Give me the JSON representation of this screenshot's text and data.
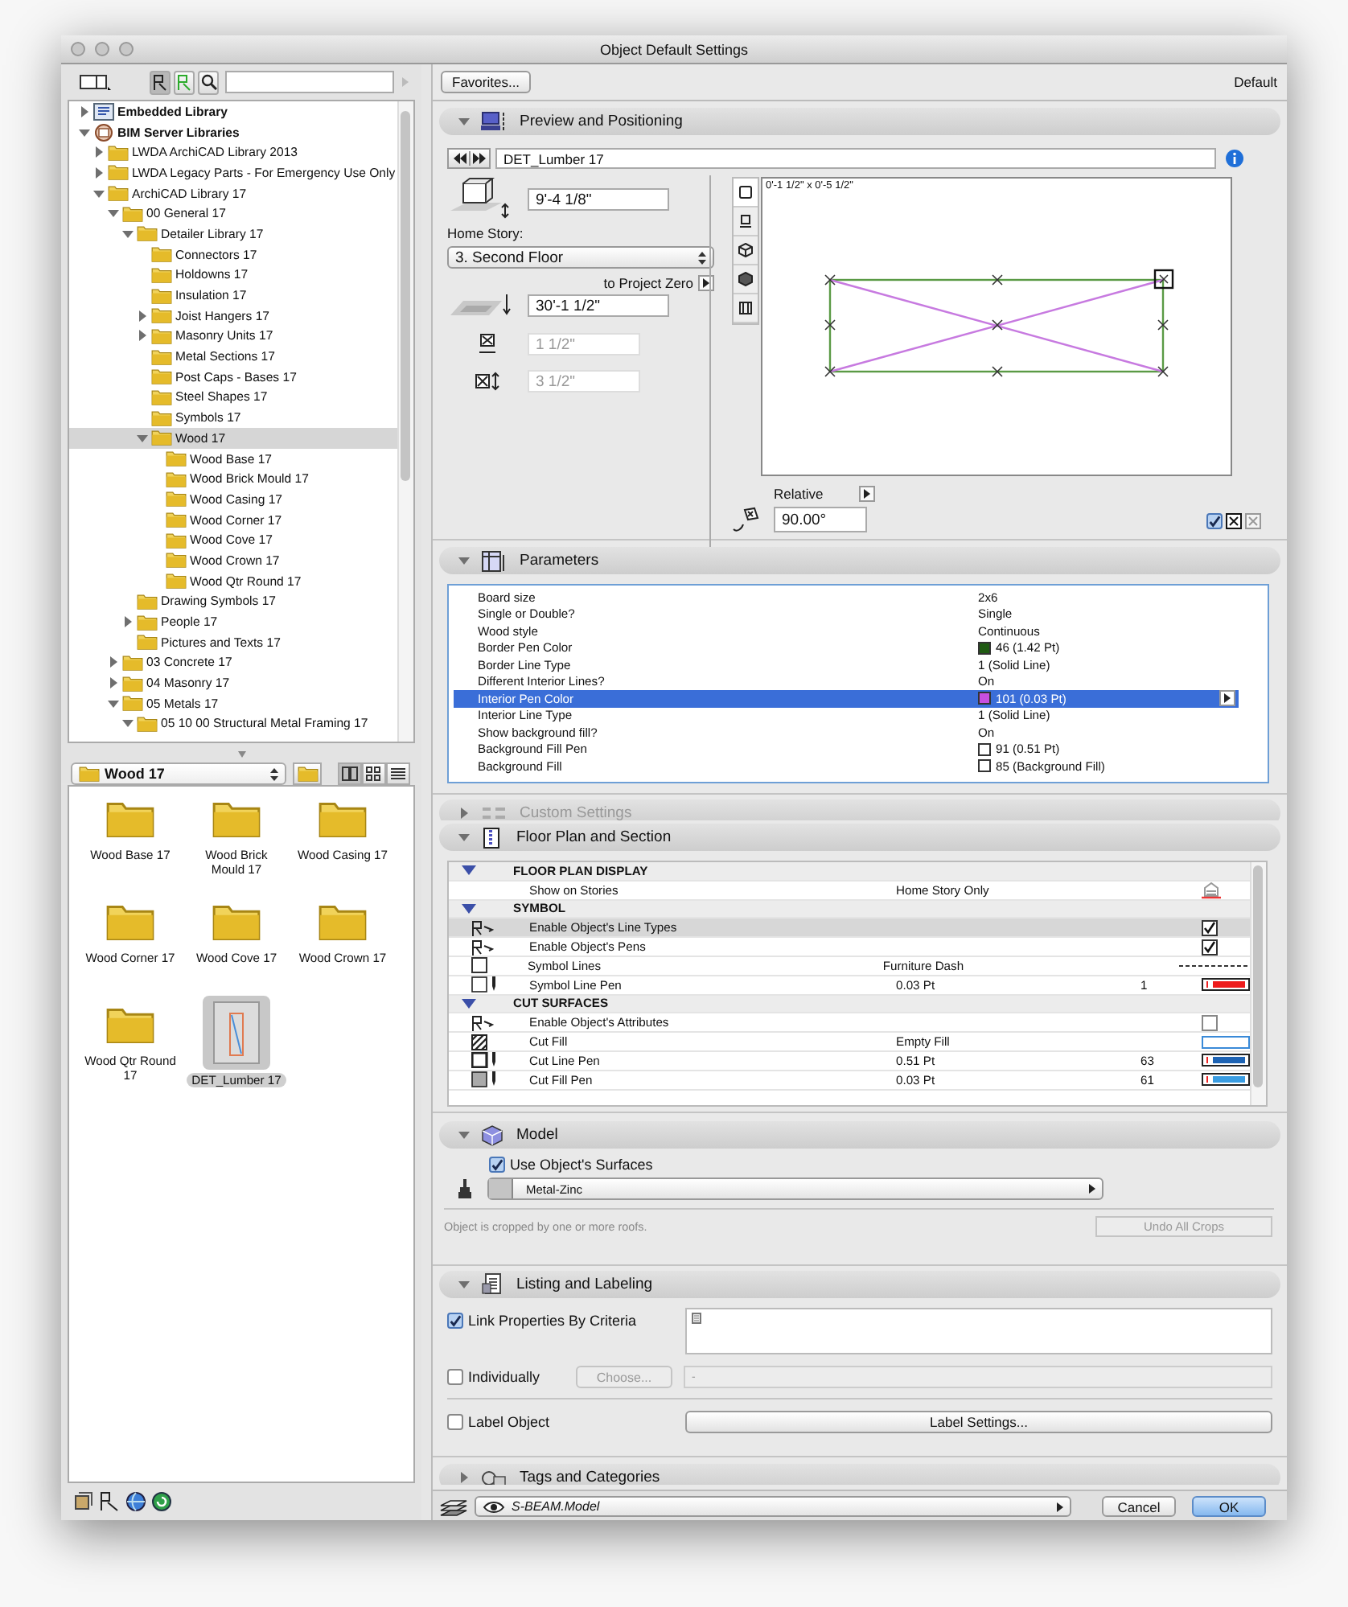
{
  "window": {
    "title": "Object Default Settings"
  },
  "tree": [
    {
      "label": "Embedded Library",
      "kind": "library",
      "expanded": false,
      "selected": false
    },
    {
      "label": "BIM Server Libraries",
      "kind": "server",
      "expanded": true,
      "selected": false,
      "children": [
        {
          "label": "LWDA ArchiCAD Library 2013",
          "kind": "folder",
          "expanded": false,
          "selected": false
        },
        {
          "label": "LWDA Legacy Parts - For Emergency Use Only",
          "kind": "folder",
          "expanded": false,
          "selected": false
        },
        {
          "label": "ArchiCAD Library 17",
          "kind": "folder",
          "expanded": true,
          "selected": false,
          "children": [
            {
              "label": "00 General 17",
              "kind": "folder",
              "expanded": true,
              "selected": false,
              "children": [
                {
                  "label": "Detailer Library 17",
                  "kind": "folder",
                  "expanded": true,
                  "selected": false,
                  "children": [
                    {
                      "label": "Connectors 17",
                      "kind": "folder",
                      "selected": false
                    },
                    {
                      "label": "Holdowns 17",
                      "kind": "folder",
                      "selected": false
                    },
                    {
                      "label": "Insulation 17",
                      "kind": "folder",
                      "selected": false
                    },
                    {
                      "label": "Joist Hangers 17",
                      "kind": "folder",
                      "expanded": false,
                      "selected": false
                    },
                    {
                      "label": "Masonry Units 17",
                      "kind": "folder",
                      "expanded": false,
                      "selected": false
                    },
                    {
                      "label": "Metal Sections 17",
                      "kind": "folder",
                      "selected": false
                    },
                    {
                      "label": "Post Caps - Bases 17",
                      "kind": "folder",
                      "selected": false
                    },
                    {
                      "label": "Steel Shapes 17",
                      "kind": "folder",
                      "selected": false
                    },
                    {
                      "label": "Symbols 17",
                      "kind": "folder",
                      "selected": false
                    },
                    {
                      "label": "Wood 17",
                      "kind": "folder",
                      "expanded": true,
                      "selected": true,
                      "children": [
                        {
                          "label": "Wood Base 17",
                          "kind": "folder",
                          "selected": false
                        },
                        {
                          "label": "Wood Brick Mould 17",
                          "kind": "folder",
                          "selected": false
                        },
                        {
                          "label": "Wood Casing 17",
                          "kind": "folder",
                          "selected": false
                        },
                        {
                          "label": "Wood Corner 17",
                          "kind": "folder",
                          "selected": false
                        },
                        {
                          "label": "Wood Cove 17",
                          "kind": "folder",
                          "selected": false
                        },
                        {
                          "label": "Wood Crown 17",
                          "kind": "folder",
                          "selected": false
                        },
                        {
                          "label": "Wood Qtr Round 17",
                          "kind": "folder",
                          "selected": false
                        }
                      ]
                    }
                  ]
                },
                {
                  "label": "Drawing Symbols 17",
                  "kind": "folder",
                  "selected": false
                },
                {
                  "label": "People 17",
                  "kind": "folder",
                  "expanded": false,
                  "selected": false
                },
                {
                  "label": "Pictures and Texts 17",
                  "kind": "folder",
                  "selected": false
                }
              ]
            },
            {
              "label": "03 Concrete 17",
              "kind": "folder",
              "expanded": false,
              "selected": false
            },
            {
              "label": "04 Masonry 17",
              "kind": "folder",
              "expanded": false,
              "selected": false
            },
            {
              "label": "05 Metals 17",
              "kind": "folder",
              "expanded": true,
              "selected": false,
              "children": [
                {
                  "label": "05 10 00 Structural Metal Framing 17",
                  "kind": "folder",
                  "expanded": true,
                  "selected": false
                }
              ]
            }
          ]
        }
      ]
    }
  ],
  "folder_select": {
    "value": "Wood 17"
  },
  "items": [
    {
      "label": "Wood Base 17",
      "kind": "folder",
      "selected": false
    },
    {
      "label": "Wood Brick Mould 17",
      "kind": "folder",
      "selected": false
    },
    {
      "label": "Wood Casing 17",
      "kind": "folder",
      "selected": false
    },
    {
      "label": "Wood Corner 17",
      "kind": "folder",
      "selected": false
    },
    {
      "label": "Wood Cove 17",
      "kind": "folder",
      "selected": false
    },
    {
      "label": "Wood Crown 17",
      "kind": "folder",
      "selected": false
    },
    {
      "label": "Wood Qtr Round 17",
      "kind": "folder",
      "selected": false
    },
    {
      "label": "DET_Lumber 17",
      "kind": "object",
      "selected": true
    }
  ],
  "favorites_button": "Favorites...",
  "default_label": "Default",
  "preview": {
    "header": {
      "title": "Preview and Positioning",
      "expanded": true,
      "disabled": false
    },
    "object_name": "DET_Lumber 17",
    "height": "9'-4 1/8\"",
    "home_story_label": "Home Story:",
    "home_story": "3. Second Floor",
    "reference_label": "to Project Zero",
    "elevation": "30'-1 1/2\"",
    "width": "1 1/2\"",
    "depth": "3 1/2\"",
    "size_label": "0'-1 1/2\" x 0'-5 1/2\"",
    "view_modes": [
      {
        "kind": "plan",
        "selected": true
      },
      {
        "kind": "section",
        "selected": false
      },
      {
        "kind": "wireframe",
        "selected": false
      },
      {
        "kind": "shaded",
        "selected": false
      },
      {
        "kind": "elevation",
        "selected": false
      }
    ],
    "angle_mode": "Relative",
    "angle": "90.00°",
    "mirrored": true
  },
  "parameters": {
    "header": {
      "title": "Parameters",
      "expanded": true,
      "disabled": false
    },
    "rows": [
      {
        "name": "Board size",
        "value": "2x6",
        "selected": false
      },
      {
        "name": "Single or Double?",
        "value": "Single",
        "selected": false
      },
      {
        "name": "Wood style",
        "value": "Continuous",
        "selected": false
      },
      {
        "name": "Border Pen Color",
        "value": "46 (1.42 Pt)",
        "color": "#1f5a12",
        "selected": false
      },
      {
        "name": "Border Line Type",
        "value": "1 (Solid Line)",
        "selected": false
      },
      {
        "name": "Different Interior Lines?",
        "value": "On",
        "selected": false
      },
      {
        "name": "Interior Pen Color",
        "value": "101 (0.03 Pt)",
        "color": "#c84fe0",
        "selected": true
      },
      {
        "name": "Interior Line Type",
        "value": "1 (Solid Line)",
        "selected": false
      },
      {
        "name": "Show background fill?",
        "value": "On",
        "selected": false
      },
      {
        "name": "Background Fill Pen",
        "value": "91 (0.51 Pt)",
        "color": "#ffffff",
        "selected": false
      },
      {
        "name": "Background Fill",
        "value": "85 (Background Fill)",
        "color": "#ffffff",
        "selected": false
      }
    ]
  },
  "custom_settings": {
    "header": {
      "title": "Custom Settings",
      "expanded": false,
      "disabled": true
    }
  },
  "floor_plan": {
    "header": {
      "title": "Floor Plan and Section",
      "expanded": true,
      "disabled": false
    },
    "rows": [
      {
        "kind": "group",
        "name": "FLOOR PLAN DISPLAY",
        "expanded": true
      },
      {
        "kind": "stories",
        "name": "Show on Stories",
        "value": "Home Story Only",
        "selected": false
      },
      {
        "kind": "group",
        "name": "SYMBOL",
        "expanded": true
      },
      {
        "kind": "check",
        "name": "Enable Object's Line Types",
        "checked": true,
        "selected": true
      },
      {
        "kind": "check",
        "name": "Enable Object's Pens",
        "checked": true,
        "selected": false
      },
      {
        "kind": "dash",
        "name": "Symbol Lines",
        "value": "Furniture Dash",
        "selected": false
      },
      {
        "kind": "pen",
        "name": "Symbol Line Pen",
        "value": "0.03 Pt",
        "number": "1",
        "color": "#ee1c1c",
        "selected": false
      },
      {
        "kind": "group",
        "name": "CUT SURFACES",
        "expanded": true
      },
      {
        "kind": "check",
        "name": "Enable Object's Attributes",
        "checked": false,
        "selected": false
      },
      {
        "kind": "fill",
        "name": "Cut Fill",
        "value": "Empty Fill",
        "selected": false
      },
      {
        "kind": "pen",
        "name": "Cut Line Pen",
        "value": "0.51 Pt",
        "number": "63",
        "color": "#1d63b4",
        "selected": false
      },
      {
        "kind": "pen",
        "name": "Cut Fill Pen",
        "value": "0.03 Pt",
        "number": "61",
        "color": "#3a9de2",
        "selected": false
      }
    ]
  },
  "model": {
    "header": {
      "title": "Model",
      "expanded": true,
      "disabled": false
    },
    "use_surfaces": {
      "label": "Use Object's Surfaces",
      "checked": true
    },
    "surface": "Metal-Zinc",
    "note": "Object is cropped by one or more roofs.",
    "undo_button": {
      "label": "Undo All Crops",
      "disabled": true
    }
  },
  "listing": {
    "header": {
      "title": "Listing and Labeling",
      "expanded": true,
      "disabled": false
    },
    "link_criteria": {
      "label": "Link Properties By Criteria",
      "checked": true
    },
    "individually": {
      "label": "Individually",
      "checked": false
    },
    "choose_button": {
      "label": "Choose...",
      "disabled": true
    },
    "criteria_value": "-",
    "label_object": {
      "label": "Label Object",
      "checked": false
    },
    "label_settings_button": "Label Settings..."
  },
  "tags": {
    "header": {
      "title": "Tags and Categories",
      "expanded": false,
      "disabled": false
    }
  },
  "footer": {
    "layer": "S-BEAM.Model",
    "cancel": "Cancel",
    "ok": "OK"
  }
}
